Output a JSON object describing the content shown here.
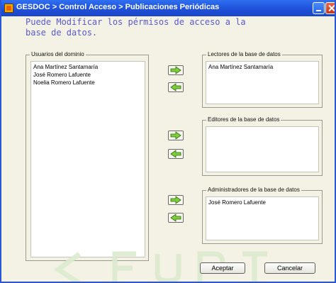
{
  "window": {
    "title": "GESDOC > Control Acceso > Publicaciones Periódicas"
  },
  "instruction": "Puede Modificar los pérmisos de acceso a la base de datos.",
  "domain_users": {
    "title": "Usuarios del dominio",
    "items": [
      "Ana Martínez Santamaría",
      "José Romero Lafuente",
      "Noelia Romero Lafuente"
    ]
  },
  "readers": {
    "title": "Lectores de la base de datos",
    "items": [
      "Ana Martínez Santamaría"
    ]
  },
  "editors": {
    "title": "Editores de la base de datos",
    "items": []
  },
  "admins": {
    "title": "Administradores de la base de datos",
    "items": [
      "José Romero Lafuente"
    ]
  },
  "buttons": {
    "accept": "Aceptar",
    "cancel": "Cancelar"
  },
  "icons": {
    "add": "arrow-right-icon",
    "remove": "arrow-left-icon"
  },
  "colors": {
    "titlebar": "#2058e0",
    "arrow_fill": "#7fcf3a",
    "instruction_text": "#5a5acc"
  }
}
